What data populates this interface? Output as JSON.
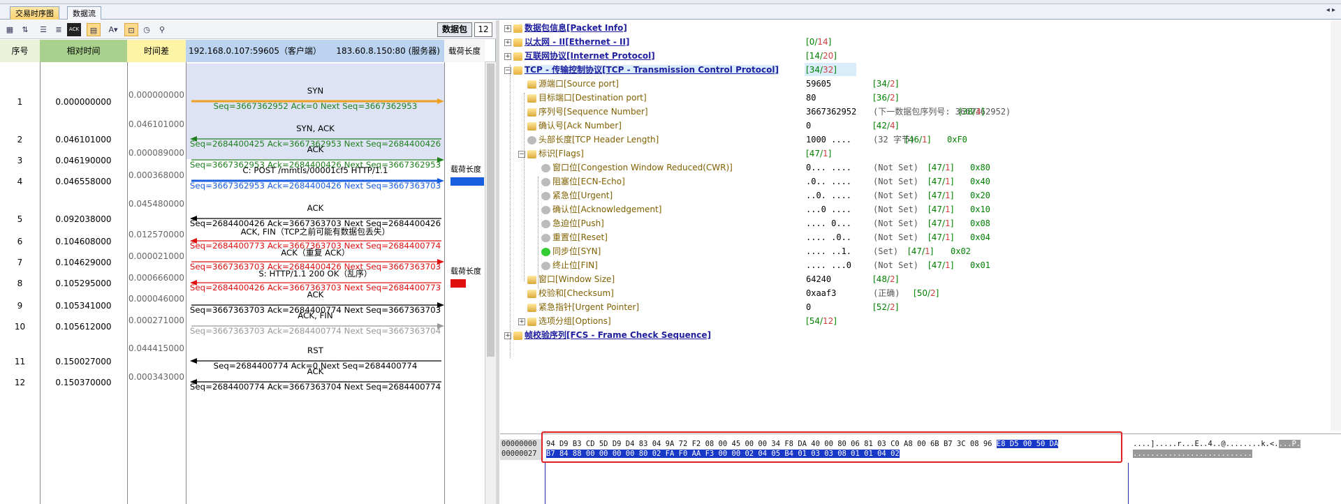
{
  "tabs": [
    {
      "label": "交易时序图"
    },
    {
      "label": "数据流"
    }
  ],
  "toolbar": {
    "packet_label": "数据包",
    "packet_count": "12"
  },
  "columns": {
    "seq": "序号",
    "rel": "相对时间",
    "diff": "时间差",
    "client": "192.168.0.107:59605（客户端）",
    "server": "183.60.8.150:80 (服务器)",
    "payload": "载荷长度"
  },
  "rows": [
    {
      "no": "1",
      "rel": "0.000000000"
    },
    {
      "no": "2",
      "rel": "0.046101000"
    },
    {
      "no": "3",
      "rel": "0.046190000"
    },
    {
      "no": "4",
      "rel": "0.046558000"
    },
    {
      "no": "5",
      "rel": "0.092038000"
    },
    {
      "no": "6",
      "rel": "0.104608000"
    },
    {
      "no": "7",
      "rel": "0.104629000"
    },
    {
      "no": "8",
      "rel": "0.105295000"
    },
    {
      "no": "9",
      "rel": "0.105341000"
    },
    {
      "no": "10",
      "rel": "0.105612000"
    },
    {
      "no": "11",
      "rel": "0.150027000"
    },
    {
      "no": "12",
      "rel": "0.150370000"
    }
  ],
  "diffs": [
    "0.000000000",
    "0.046101000",
    "0.000089000",
    "0.000368000",
    "0.045480000",
    "0.012570000",
    "0.000021000",
    "0.000666000",
    "0.000046000",
    "0.000271000",
    "0.044415000",
    "0.000343000"
  ],
  "arrows": [
    {
      "label": "SYN",
      "sub": "Seq=3667362952  Ack=0  Next Seq=3667362953",
      "color": "#f0a020",
      "sub_color": "#208020"
    },
    {
      "label": "SYN, ACK",
      "sub": "Seq=2684400425  Ack=3667362953  Next Seq=2684400426",
      "color": "#208020",
      "sub_color": "#208020"
    },
    {
      "label": "ACK",
      "sub": "Seq=3667362953  Ack=2684400426  Next Seq=3667362953",
      "color": "#208020",
      "sub_color": "#208020"
    },
    {
      "label": "C: POST /mmtls/00001cf5 HTTP/1.1",
      "sub": "Seq=3667362953  Ack=2684400426  Next Seq=3667363703",
      "color": "#1a5ee0",
      "sub_color": "#1a5ee0"
    },
    {
      "label": "ACK",
      "sub": "Seq=2684400426  Ack=3667363703  Next Seq=2684400426",
      "color": "#000",
      "sub_color": "#000"
    },
    {
      "label": "ACK, FIN（TCP之前可能有数据包丢失）",
      "sub": "Seq=2684400773  Ack=3667363703  Next Seq=2684400774",
      "color": "#e01010",
      "sub_color": "#e01010"
    },
    {
      "label": "ACK（重复 ACK）",
      "sub": "Seq=3667363703  Ack=2684400426  Next Seq=3667363703",
      "color": "#e01010",
      "sub_color": "#e01010"
    },
    {
      "label": "S: HTTP/1.1 200 OK（乱序）",
      "sub": "Seq=2684400426  Ack=3667363703  Next Seq=2684400773",
      "color": "#e01010",
      "sub_color": "#e01010"
    },
    {
      "label": "ACK",
      "sub": "Seq=3667363703  Ack=2684400774  Next Seq=3667363703",
      "color": "#000",
      "sub_color": "#000"
    },
    {
      "label": "ACK, FIN",
      "sub": "Seq=3667363703  Ack=2684400774  Next Seq=3667363704",
      "color": "#999",
      "sub_color": "#999"
    },
    {
      "label": "RST",
      "sub": "Seq=2684400774  Ack=0  Next Seq=2684400774",
      "color": "#000",
      "sub_color": "#000"
    },
    {
      "label": "ACK",
      "sub": "Seq=2684400774  Ack=3667363704  Next Seq=2684400774",
      "color": "#000",
      "sub_color": "#000"
    }
  ],
  "payload_labels": [
    "载荷长度",
    "载荷长度"
  ],
  "payload_colors": [
    "#1a5ee0",
    "#e01010"
  ],
  "tree": {
    "packet_info": "数据包信息[Packet Info]",
    "ethernet": "以太网 - II[Ethernet - II]",
    "ethernet_pos": "0",
    "ethernet_len": "14",
    "ip": "互联网协议[Internet Protocol]",
    "ip_pos": "14",
    "ip_len": "20",
    "tcp": "TCP - 传输控制协议[TCP - Transmission Control Protocol]",
    "tcp_pos": "34",
    "tcp_len": "32",
    "fields": [
      {
        "name": "源端口[Source port]",
        "val": "59605",
        "pos": "34",
        "len": "2"
      },
      {
        "name": "目标端口[Destination port]",
        "val": "80",
        "pos": "36",
        "len": "2"
      },
      {
        "name": "序列号[Sequence Number]",
        "val": "3667362952",
        "note": "(下一数据包序列号: 3667362952)",
        "pos": "38",
        "len": "4"
      },
      {
        "name": "确认号[Ack Number]",
        "val": "0",
        "pos": "42",
        "len": "4"
      },
      {
        "name": "头部长度[TCP Header Length]",
        "val": "1000 ....",
        "note": "(32 字节)",
        "pos": "46",
        "len": "1",
        "hex": "0xF0"
      }
    ],
    "flags_label": "标识[Flags]",
    "flags_pos": "47",
    "flags_len": "1",
    "flags": [
      {
        "name": "窗口位[Congestion Window Reduced(CWR)]",
        "val": "0... ....",
        "state": "(Not Set)",
        "hex": "0x80"
      },
      {
        "name": "阻塞位[ECN-Echo]",
        "val": ".0.. ....",
        "state": "(Not Set)",
        "hex": "0x40"
      },
      {
        "name": "紧急位[Urgent]",
        "val": "..0. ....",
        "state": "(Not Set)",
        "hex": "0x20"
      },
      {
        "name": "确认位[Acknowledgement]",
        "val": "...0 ....",
        "state": "(Not Set)",
        "hex": "0x10"
      },
      {
        "name": "急迫位[Push]",
        "val": ".... 0...",
        "state": "(Not Set)",
        "hex": "0x08"
      },
      {
        "name": "重置位[Reset]",
        "val": ".... .0..",
        "state": "(Not Set)",
        "hex": "0x04"
      },
      {
        "name": "同步位[SYN]",
        "val": ".... ..1.",
        "state": "(Set)",
        "hex": "0x02"
      },
      {
        "name": "终止位[FIN]",
        "val": ".... ...0",
        "state": "(Not Set)",
        "hex": "0x01"
      }
    ],
    "flag_pos": "47",
    "flag_len": "1",
    "rest": [
      {
        "name": "窗口[Window Size]",
        "val": "64240",
        "pos": "48",
        "len": "2"
      },
      {
        "name": "校验和[Checksum]",
        "val": "0xaaf3",
        "note": "(正确)",
        "pos": "50",
        "len": "2"
      },
      {
        "name": "紧急指针[Urgent Pointer]",
        "val": "0",
        "pos": "52",
        "len": "2"
      },
      {
        "name": "选项分组[Options]",
        "val": "",
        "pos": "54",
        "len": "12"
      }
    ],
    "fcs": "帧校验序列[FCS - Frame Check Sequence]"
  },
  "hex": {
    "offsets": [
      "00000000",
      "00000027"
    ],
    "line1_a": "94 D9 B3 CD 5D D9 D4 83 04 9A 72 F2 08 00 45 00 00 34 F8 DA 40 00 80 06 81 03 C0 A8 00 6B B7 3C 08 96 ",
    "line1_b": "E8 D5 00 50 DA",
    "line2": "B7 84 88 00 00 00 00 80 02 FA F0 AA F3 00 00 02 04 05 B4 01 03 03 08 01 01 04 02",
    "ascii1_a": "....].....r...E..4..@........k.<.",
    "ascii1_b": "...P.",
    "ascii2": "..........................."
  }
}
